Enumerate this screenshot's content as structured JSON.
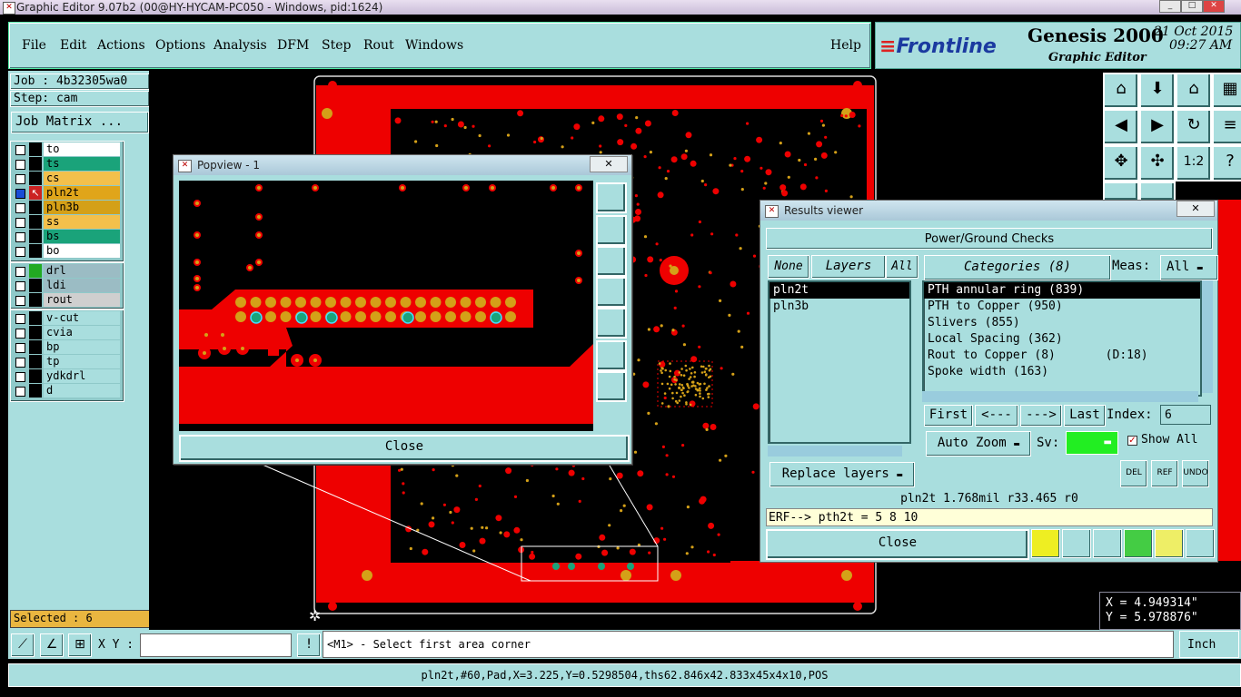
{
  "window": {
    "title": "Graphic Editor 9.07b2 (00@HY-HYCAM-PC050 - Windows, pid:1624)"
  },
  "menu": {
    "items": [
      "File",
      "Edit",
      "Actions",
      "Options",
      "Analysis",
      "DFM",
      "Step",
      "Rout",
      "Windows"
    ],
    "help": "Help"
  },
  "logo": {
    "brand": "Frontline",
    "product": "Genesis 2000",
    "subtitle": "Graphic Editor",
    "date": "21 Oct 2015",
    "time": "09:27 AM"
  },
  "left": {
    "job": "Job : 4b32305wa0",
    "step": "Step: cam",
    "job_matrix": "Job Matrix ...",
    "selected": "Selected : 6",
    "groups": [
      [
        {
          "name": "to",
          "color": "#ffffff",
          "checked": false
        },
        {
          "name": "ts",
          "color": "#1aa37a",
          "checked": false
        },
        {
          "name": "cs",
          "color": "#f3c04b",
          "checked": false
        },
        {
          "name": "pln2t",
          "color": "#e0a51a",
          "checked": true,
          "active": true
        },
        {
          "name": "pln3b",
          "color": "#d4a018",
          "checked": false
        },
        {
          "name": "ss",
          "color": "#f3c04b",
          "checked": false
        },
        {
          "name": "bs",
          "color": "#1aa37a",
          "checked": false
        },
        {
          "name": "bo",
          "color": "#ffffff",
          "checked": false
        }
      ],
      [
        {
          "name": "drl",
          "color": "#9bbcc4",
          "checked": false
        },
        {
          "name": "ldi",
          "color": "#9bbcc4",
          "checked": false
        },
        {
          "name": "rout",
          "color": "#cfcfcf",
          "checked": false
        }
      ],
      [
        {
          "name": "v-cut",
          "color": "#a9dede",
          "checked": false
        },
        {
          "name": "cvia",
          "color": "#a9dede",
          "checked": false
        },
        {
          "name": "bp",
          "color": "#a9dede",
          "checked": false
        },
        {
          "name": "tp",
          "color": "#a9dede",
          "checked": false
        },
        {
          "name": "ydkdrl",
          "color": "#a9dede",
          "checked": false
        },
        {
          "name": "d",
          "color": "#a9dede",
          "checked": false
        }
      ]
    ]
  },
  "popview": {
    "title": "Popview - 1",
    "close": "Close"
  },
  "results": {
    "title": "Results viewer",
    "heading": "Power/Ground Checks",
    "none": "None",
    "layers": "Layers",
    "all": "All",
    "categories": "Categories (8)",
    "meas_label": "Meas:",
    "meas_value": "All",
    "layer_list": [
      "pln2t",
      "pln3b"
    ],
    "category_list": [
      "PTH annular ring (839)",
      "PTH to Copper (950)",
      "Slivers (855)",
      "Local Spacing (362)",
      "Rout to Copper (8)       (D:18)",
      "Spoke width (163)"
    ],
    "first": "First",
    "prev": "<---",
    "next": "--->",
    "last": "Last",
    "index_label": "Index:",
    "index_value": "6",
    "auto_zoom": "Auto Zoom",
    "sv_label": "Sv:",
    "show_all": "Show All",
    "replace_layers": "Replace layers",
    "del": "DEL",
    "ref": "REF",
    "undo": "UNDO",
    "info_line": "pln2t 1.768mil  r33.465  r0",
    "erf_line": "ERF--> pth2t = 5 8 10",
    "close": "Close"
  },
  "coords": {
    "x": "X = 4.949314\"",
    "y": "Y = 5.978876\""
  },
  "bottom": {
    "xy_label": "X Y :",
    "prompt": "<M1> - Select first area corner",
    "units": "Inch",
    "status": "pln2t,#60,Pad,X=3.225,Y=0.5298504,ths62.846x42.833x45x4x10,POS"
  }
}
